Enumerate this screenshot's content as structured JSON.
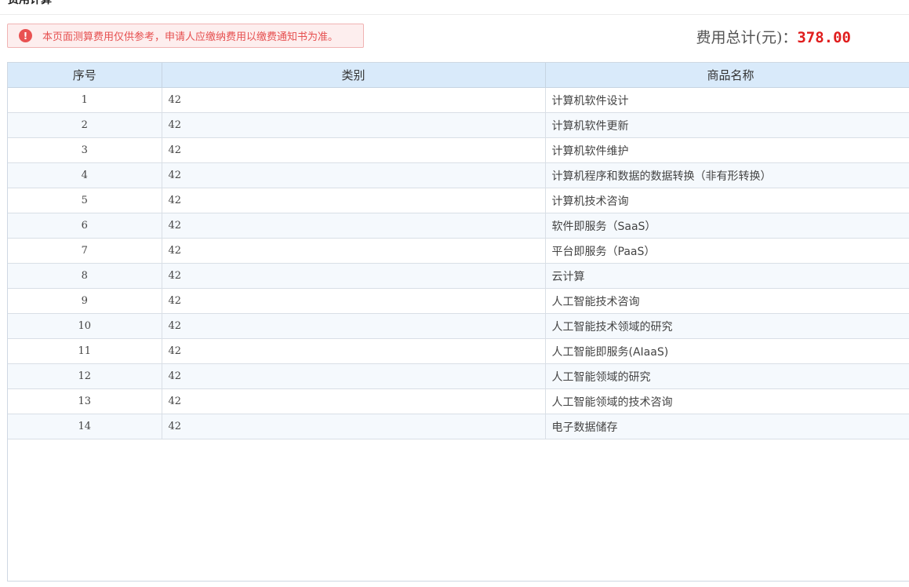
{
  "header": {
    "title": "费用计算"
  },
  "notice": {
    "icon": "exclamation-circle-icon",
    "icon_glyph": "!",
    "text": "本页面测算费用仅供参考，申请人应缴纳费用以缴费通知书为准。",
    "color": "#e65050"
  },
  "total": {
    "label": "费用总计(元)：",
    "amount": "378.00",
    "amount_color": "#e01e1e"
  },
  "table": {
    "columns": [
      "序号",
      "类别",
      "商品名称"
    ],
    "rows": [
      {
        "index": "1",
        "category": "42",
        "name": "计算机软件设计"
      },
      {
        "index": "2",
        "category": "42",
        "name": "计算机软件更新"
      },
      {
        "index": "3",
        "category": "42",
        "name": "计算机软件维护"
      },
      {
        "index": "4",
        "category": "42",
        "name": "计算机程序和数据的数据转换（非有形转换）"
      },
      {
        "index": "5",
        "category": "42",
        "name": "计算机技术咨询"
      },
      {
        "index": "6",
        "category": "42",
        "name": "软件即服务（SaaS）"
      },
      {
        "index": "7",
        "category": "42",
        "name": "平台即服务（PaaS）"
      },
      {
        "index": "8",
        "category": "42",
        "name": "云计算"
      },
      {
        "index": "9",
        "category": "42",
        "name": "人工智能技术咨询"
      },
      {
        "index": "10",
        "category": "42",
        "name": "人工智能技术领域的研究"
      },
      {
        "index": "11",
        "category": "42",
        "name": "人工智能即服务(AIaaS)"
      },
      {
        "index": "12",
        "category": "42",
        "name": "人工智能领域的研究"
      },
      {
        "index": "13",
        "category": "42",
        "name": "人工智能领域的技术咨询"
      },
      {
        "index": "14",
        "category": "42",
        "name": "电子数据储存"
      }
    ]
  },
  "colors": {
    "header_bg": "#d9eafa",
    "stripe_bg": "#f5f9fd",
    "notice_bg": "#fdeeee"
  }
}
